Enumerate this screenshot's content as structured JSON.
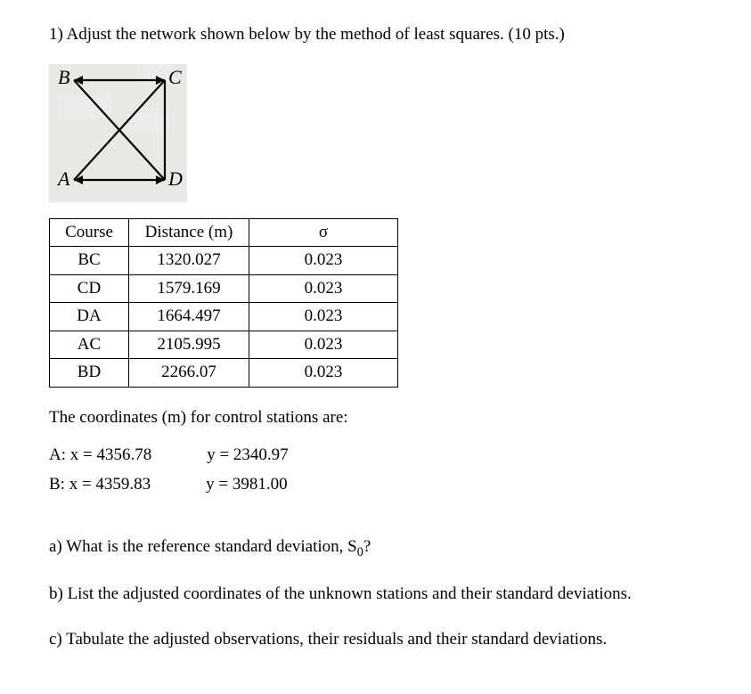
{
  "problem": {
    "heading": "1) Adjust the network shown below by the method of least squares. (10 pts.)"
  },
  "figure": {
    "labels": {
      "top_left": "B",
      "top_right": "C",
      "bottom_left": "A",
      "bottom_right": "D"
    }
  },
  "table": {
    "headers": [
      "Course",
      "Distance (m)",
      "σ"
    ],
    "rows": [
      {
        "course": "BC",
        "distance": "1320.027",
        "sigma": "0.023"
      },
      {
        "course": "CD",
        "distance": "1579.169",
        "sigma": "0.023"
      },
      {
        "course": "DA",
        "distance": "1664.497",
        "sigma": "0.023"
      },
      {
        "course": "AC",
        "distance": "2105.995",
        "sigma": "0.023"
      },
      {
        "course": "BD",
        "distance": "2266.07",
        "sigma": "0.023"
      }
    ]
  },
  "coords": {
    "intro": "The coordinates (m) for control stations are:",
    "A_x": "A: x = 4356.78",
    "A_y": "y = 2340.97",
    "B_x": "B: x = 4359.83",
    "B_y": "y = 3981.00"
  },
  "questions": {
    "a_prefix": "a) What is the reference standard deviation, S",
    "a_sub": "0",
    "a_suffix": "?",
    "b": "b) List the adjusted coordinates of the unknown stations and their standard deviations.",
    "c": "c) Tabulate the adjusted observations, their residuals and their standard deviations."
  }
}
